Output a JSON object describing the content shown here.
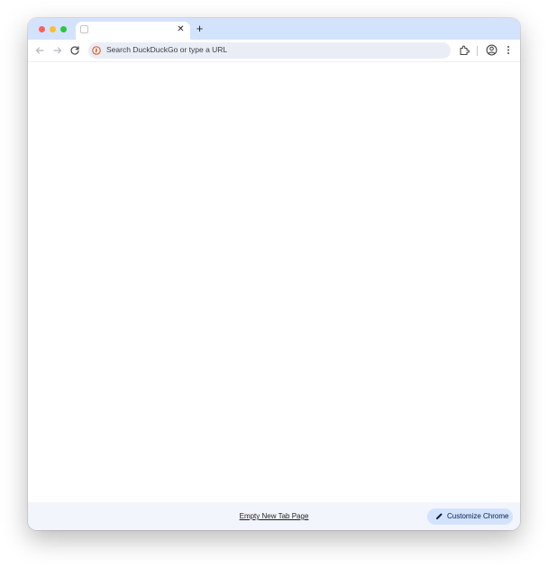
{
  "window": {
    "traffic_lights": [
      "close",
      "minimize",
      "maximize"
    ]
  },
  "tab": {
    "title": "",
    "close_glyph": "✕",
    "favicon": "blank-page-icon"
  },
  "new_tab": {
    "glyph": "+"
  },
  "toolbar": {
    "back_icon": "arrow-left-icon",
    "forward_icon": "arrow-right-icon",
    "reload_icon": "reload-icon",
    "extensions_icon": "puzzle-icon",
    "profile_icon": "account-circle-icon",
    "menu_icon": "kebab-menu-icon"
  },
  "omnibox": {
    "search_engine_icon": "duckduckgo-icon",
    "placeholder": "Search DuckDuckGo or type a URL"
  },
  "footer": {
    "link_text": "Empty New Tab Page",
    "customize_label": "Customize Chrome",
    "customize_icon": "pencil-icon"
  },
  "colors": {
    "tabstrip_bg": "#d3e3fd",
    "omnibox_bg": "#e9eef6",
    "footer_bg": "#f2f5fc",
    "customize_btn_bg": "#d3e3fd"
  }
}
